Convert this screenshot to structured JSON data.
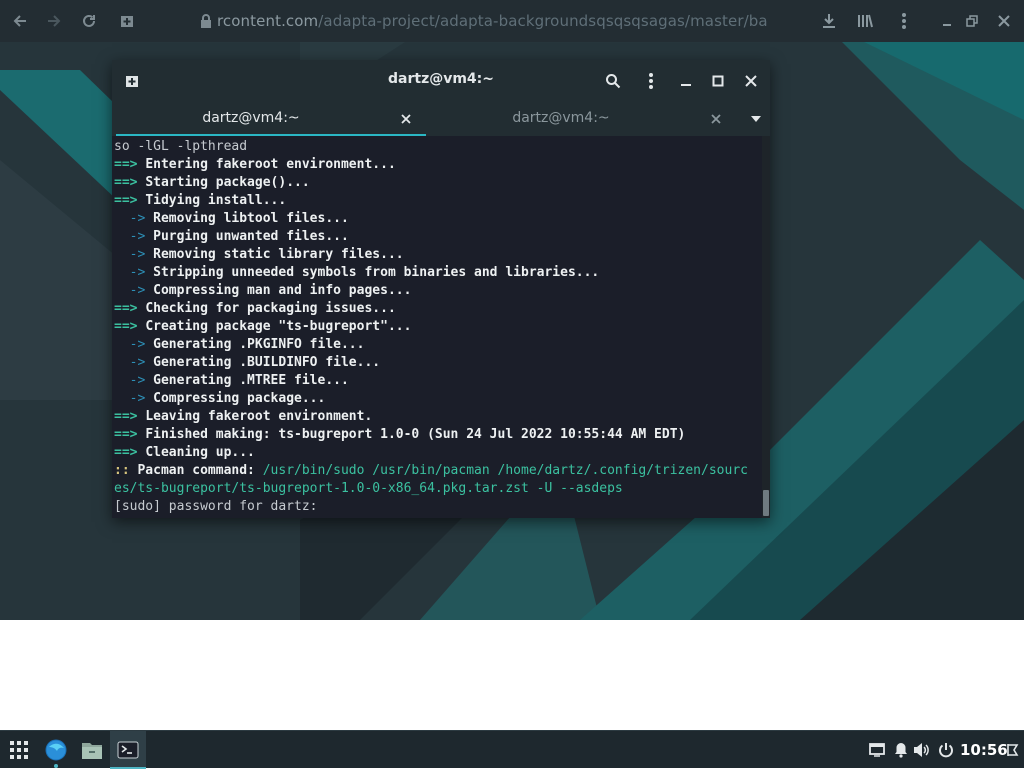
{
  "browser": {
    "url_host": "rcontent.com",
    "url_path": "/adapta-project/adapta-backgroundsqsqsqsagas/master/backgrounds"
  },
  "terminal": {
    "title": "dartz@vm4:~",
    "tabs": [
      {
        "label": "dartz@vm4:~",
        "active": true
      },
      {
        "label": "dartz@vm4:~",
        "active": false
      }
    ],
    "lines": [
      [
        {
          "t": "so -lGL -lpthread",
          "s": "n"
        }
      ],
      [
        {
          "t": "==> ",
          "s": "g"
        },
        {
          "t": "Entering fakeroot environment...",
          "s": "b"
        }
      ],
      [
        {
          "t": "==> ",
          "s": "g"
        },
        {
          "t": "Starting package()...",
          "s": "b"
        }
      ],
      [
        {
          "t": "==> ",
          "s": "g"
        },
        {
          "t": "Tidying install...",
          "s": "b"
        }
      ],
      [
        {
          "t": "  -> ",
          "s": "c"
        },
        {
          "t": "Removing libtool files...",
          "s": "b"
        }
      ],
      [
        {
          "t": "  -> ",
          "s": "c"
        },
        {
          "t": "Purging unwanted files...",
          "s": "b"
        }
      ],
      [
        {
          "t": "  -> ",
          "s": "c"
        },
        {
          "t": "Removing static library files...",
          "s": "b"
        }
      ],
      [
        {
          "t": "  -> ",
          "s": "c"
        },
        {
          "t": "Stripping unneeded symbols from binaries and libraries...",
          "s": "b"
        }
      ],
      [
        {
          "t": "  -> ",
          "s": "c"
        },
        {
          "t": "Compressing man and info pages...",
          "s": "b"
        }
      ],
      [
        {
          "t": "==> ",
          "s": "g"
        },
        {
          "t": "Checking for packaging issues...",
          "s": "b"
        }
      ],
      [
        {
          "t": "==> ",
          "s": "g"
        },
        {
          "t": "Creating package \"ts-bugreport\"...",
          "s": "b"
        }
      ],
      [
        {
          "t": "  -> ",
          "s": "c"
        },
        {
          "t": "Generating .PKGINFO file...",
          "s": "b"
        }
      ],
      [
        {
          "t": "  -> ",
          "s": "c"
        },
        {
          "t": "Generating .BUILDINFO file...",
          "s": "b"
        }
      ],
      [
        {
          "t": "  -> ",
          "s": "c"
        },
        {
          "t": "Generating .MTREE file...",
          "s": "b"
        }
      ],
      [
        {
          "t": "  -> ",
          "s": "c"
        },
        {
          "t": "Compressing package...",
          "s": "b"
        }
      ],
      [
        {
          "t": "==> ",
          "s": "g"
        },
        {
          "t": "Leaving fakeroot environment.",
          "s": "b"
        }
      ],
      [
        {
          "t": "==> ",
          "s": "g"
        },
        {
          "t": "Finished making: ts-bugreport 1.0-0 (Sun 24 Jul 2022 10:55:44 AM EDT)",
          "s": "b"
        }
      ],
      [
        {
          "t": "==> ",
          "s": "g"
        },
        {
          "t": "Cleaning up...",
          "s": "b"
        }
      ],
      [
        {
          "t": ":: ",
          "s": "y"
        },
        {
          "t": "Pacman command: ",
          "s": "b"
        },
        {
          "t": "/usr/bin/sudo /usr/bin/pacman /home/dartz/.config/trizen/sourc",
          "s": "p"
        }
      ],
      [
        {
          "t": "es/ts-bugreport/ts-bugreport-1.0-0-x86_64.pkg.tar.zst -U --asdeps",
          "s": "p"
        }
      ],
      [
        {
          "t": "[sudo] password for dartz: ",
          "s": "n"
        }
      ]
    ]
  },
  "taskbar": {
    "clock": "10:56"
  },
  "colors": {
    "accent": "#2bb7c4",
    "terminal_bg": "#1b1e29",
    "arrow_green": "#3bc1a0",
    "arrow_blue": "#2d8fb6"
  },
  "icons": [
    "nav-back-icon",
    "nav-forward-icon",
    "reload-icon",
    "new-tab-icon",
    "lock-icon",
    "download-icon",
    "library-icon",
    "kebab-menu-icon",
    "restore-icon",
    "close-icon",
    "search-icon",
    "minimize-icon",
    "maximize-icon",
    "app-grid-icon",
    "browser-icon",
    "files-icon",
    "terminal-icon",
    "display-icon",
    "bell-icon",
    "volume-icon",
    "power-icon"
  ]
}
